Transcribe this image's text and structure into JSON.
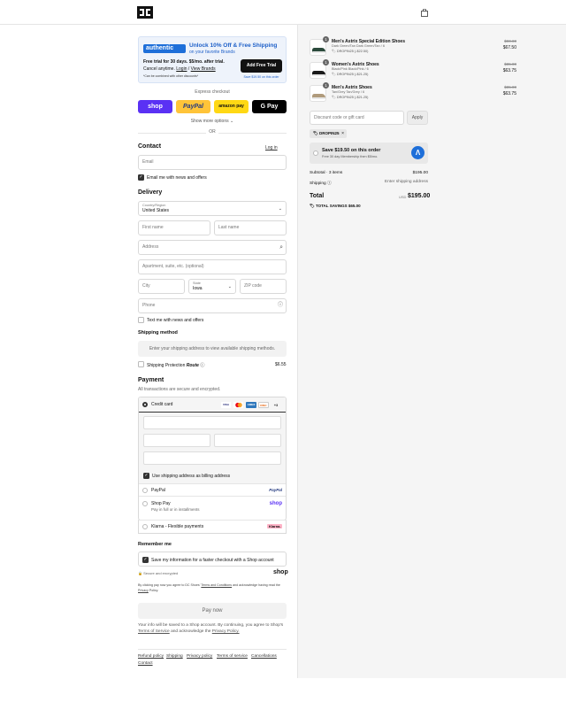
{
  "header": {
    "logo_text": "DC",
    "icons": {
      "logo": "dc-logo-icon",
      "cart": "shopping-bag-icon"
    }
  },
  "promo": {
    "logo_text": "authentic",
    "title": "Unlock 10% Off & Free Shipping",
    "subtitle": "on your favorite Brands",
    "trial_line": "Free trial for 30 days. $5/mo. after trial.",
    "cancel_text": "Cancel anytime.",
    "login_link": "Login",
    "view_brands_link": "View Brands",
    "fine_print": "*Can be combined with other discounts*",
    "button": "Add Free Trial",
    "save_text": "Save $19.50 on this order"
  },
  "express": {
    "label": "Express checkout",
    "shop": "shop",
    "paypal": "PayPal",
    "amazon": "amazon pay",
    "gpay": "G Pay",
    "show_more": "Show more options ⌄",
    "or": "OR"
  },
  "contact": {
    "title": "Contact",
    "login": "Log in",
    "email_placeholder": "Email",
    "news_label": "Email me with news and offers",
    "news_checked": true
  },
  "delivery": {
    "title": "Delivery",
    "country_label": "Country/Region",
    "country_value": "United States",
    "first_name": "First name",
    "last_name": "Last name",
    "address": "Address",
    "apartment": "Apartment, suite, etc. (optional)",
    "city": "City",
    "state_label": "State",
    "state_value": "Iowa",
    "zip": "ZIP code",
    "phone": "Phone",
    "text_label": "Text me with news and offers",
    "text_checked": false
  },
  "shipping": {
    "title": "Shipping method",
    "message": "Enter your shipping address to view available shipping methods.",
    "protection_label": "Shipping Protection",
    "protection_brand": "Route",
    "protection_price": "$6.55"
  },
  "payment": {
    "title": "Payment",
    "subtitle": "All transactions are secure and encrypted.",
    "credit_card": "Credit card",
    "cards": [
      "VISA",
      "MC",
      "AMEX",
      "DISC"
    ],
    "more_cards": "+3",
    "billing_label": "Use shipping address as billing address",
    "billing_checked": true,
    "options": [
      {
        "label": "PayPal",
        "sub": "",
        "badge": "PayPal"
      },
      {
        "label": "Shop Pay",
        "sub": "Pay in full or in installments",
        "badge": "shop"
      },
      {
        "label": "Klarna - Flexible payments",
        "sub": "",
        "badge": "Klarna."
      }
    ]
  },
  "remember": {
    "title": "Remember me",
    "save_label": "Save my information for a faster checkout with a Shop account",
    "save_checked": true,
    "secure": "Secure and encrypted",
    "shop_word": "shop",
    "terms_pre": "By clicking pay now you agree to DC Shoes'",
    "terms_link": "Terms and Conditions",
    "terms_mid": "and acknowledge having read the",
    "privacy_link": "Privacy",
    "privacy_end": "Policy."
  },
  "pay_now": "Pay now",
  "info": {
    "text": "Your info will be saved to a Shop account. By continuing, you agree to Shop's",
    "terms": "Terms of Service",
    "and": "and acknowledge the",
    "privacy": "Privacy Policy."
  },
  "footer": [
    "Refund policy",
    "Shipping",
    "Privacy policy",
    "Terms of service",
    "Cancellations",
    "Contact"
  ],
  "cart": {
    "items": [
      {
        "qty": "1",
        "name": "Men's Astrix Special Edition Shoes",
        "variant": "Dark Green/Tan Dark Green/Tan / 6",
        "discount": "DROPIN25 (-$22.50)",
        "orig": "$90.00",
        "price": "$67.50",
        "color": "#2b4a3c"
      },
      {
        "qty": "1",
        "name": "Women's Astrix Shoes",
        "variant": "Black/Pink Black/Pink / 6",
        "discount": "DROPIN25 (-$21.25)",
        "orig": "$85.00",
        "price": "$63.75",
        "color": "#1a1a1a"
      },
      {
        "qty": "1",
        "name": "Men's Astrix Shoes",
        "variant": "Tan/Grey Tan/Grey / 6",
        "discount": "DROPIN25 (-$21.25)",
        "orig": "$85.00",
        "price": "$63.75",
        "color": "#b09b7c"
      }
    ],
    "discount_placeholder": "Discount code or gift card",
    "apply": "Apply",
    "applied_code": "DROPIN25",
    "member_title": "Save $19.50 on this order",
    "member_sub": "Free 30 day Membership then $5/mo.",
    "subtotal_label": "Subtotal · 3 items",
    "subtotal_value": "$195.00",
    "shipping_label": "Shipping",
    "shipping_value": "Enter shipping address",
    "total_label": "Total",
    "currency": "USD",
    "total_value": "$195.00",
    "savings": "TOTAL SAVINGS  $65.00"
  }
}
